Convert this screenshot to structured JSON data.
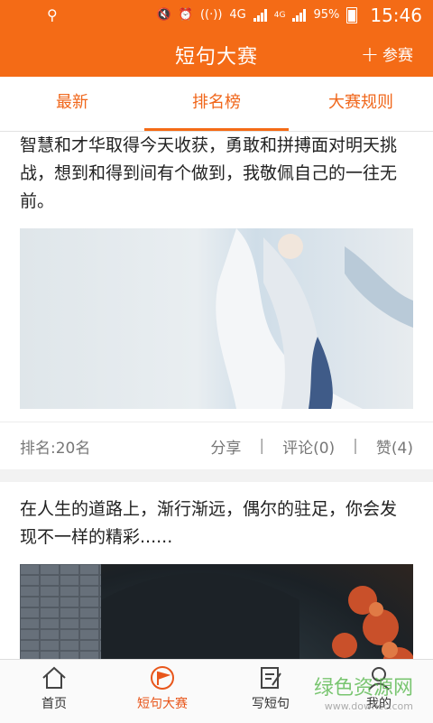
{
  "status_bar": {
    "usb_icon": "usb-icon",
    "network": "4G",
    "network2": "4G",
    "battery": "95%",
    "time": "15:46"
  },
  "header": {
    "title": "短句大赛",
    "join_label": "参赛"
  },
  "tabs": [
    {
      "label": "最新"
    },
    {
      "label": "排名榜"
    },
    {
      "label": "大赛规则"
    }
  ],
  "posts": [
    {
      "text": "智慧和才华取得今天收获，勇敢和拼搏面对明天挑战，想到和得到间有个做到，我敬佩自己的一往无前。",
      "rank": "排名:20名",
      "share": "分享",
      "comment": "评论(0)",
      "like": "赞(4)"
    },
    {
      "text": "在人生的道路上，渐行渐远，偶尔的驻足，你会发现不一样的精彩......"
    }
  ],
  "bottom_nav": [
    {
      "label": "首页",
      "icon": "home-icon"
    },
    {
      "label": "短句大赛",
      "icon": "flag-icon"
    },
    {
      "label": "写短句",
      "icon": "edit-icon"
    },
    {
      "label": "我的",
      "icon": "user-icon"
    }
  ],
  "watermark": {
    "line1": "绿色资源网",
    "line2": "www.downcc.com"
  },
  "colors": {
    "accent": "#f46b16",
    "active_tab": "#f0661a",
    "watermark": "#59b84e"
  }
}
